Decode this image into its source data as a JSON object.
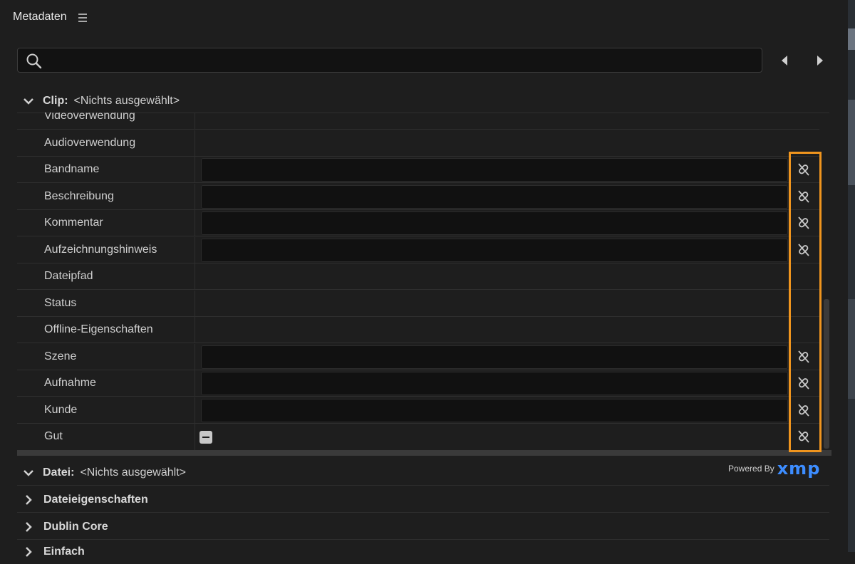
{
  "panel": {
    "title": "Metadaten"
  },
  "search": {
    "value": "",
    "placeholder": ""
  },
  "clip_section": {
    "key": "Clip:",
    "value": "<Nichts ausgewählt>"
  },
  "rows": [
    {
      "label": "Videoverwendung",
      "field": false,
      "link": false,
      "checkbox": false
    },
    {
      "label": "Audioverwendung",
      "field": false,
      "link": false,
      "checkbox": false
    },
    {
      "label": "Bandname",
      "field": true,
      "link": true,
      "checkbox": false
    },
    {
      "label": "Beschreibung",
      "field": true,
      "link": true,
      "checkbox": false
    },
    {
      "label": "Kommentar",
      "field": true,
      "link": true,
      "checkbox": false
    },
    {
      "label": "Aufzeichnungshinweis",
      "field": true,
      "link": true,
      "checkbox": false
    },
    {
      "label": "Dateipfad",
      "field": false,
      "link": false,
      "checkbox": false
    },
    {
      "label": "Status",
      "field": false,
      "link": false,
      "checkbox": false
    },
    {
      "label": "Offline-Eigenschaften",
      "field": false,
      "link": false,
      "checkbox": false
    },
    {
      "label": "Szene",
      "field": true,
      "link": true,
      "checkbox": false
    },
    {
      "label": "Aufnahme",
      "field": true,
      "link": true,
      "checkbox": false
    },
    {
      "label": "Kunde",
      "field": true,
      "link": true,
      "checkbox": false
    },
    {
      "label": "Gut",
      "field": false,
      "link": true,
      "checkbox": true
    }
  ],
  "file_section": {
    "key": "Datei:",
    "value": "<Nichts ausgewählt>"
  },
  "powered_by": {
    "text": "Powered By",
    "logo": "xmp"
  },
  "collapsed_sections": [
    {
      "label": "Dateieigenschaften"
    },
    {
      "label": "Dublin Core"
    },
    {
      "label": "Einfach"
    }
  ],
  "colors": {
    "highlight": "#f0951e",
    "xmp_blue": "#3d8dff",
    "background": "#1e1e1e",
    "field": "#111111"
  },
  "icons": {
    "menu": "hamburger-icon",
    "search": "search-icon",
    "prev": "triangle-left-icon",
    "next": "triangle-right-icon",
    "link": "unlink-icon"
  }
}
